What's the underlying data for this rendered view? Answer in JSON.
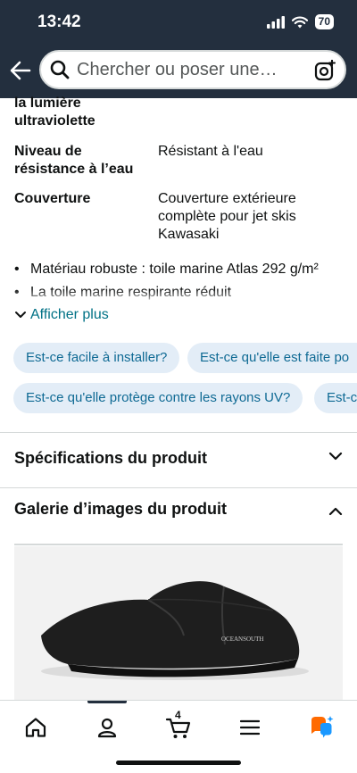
{
  "status": {
    "time": "13:42",
    "battery": "70"
  },
  "search": {
    "placeholder": "Chercher ou poser une…"
  },
  "specs": [
    {
      "key": "la lumière ultraviolette",
      "value": ""
    },
    {
      "key": "Niveau de résistance à l’eau",
      "value": "Résistant à l'eau"
    },
    {
      "key": "Couverture",
      "value": "Couverture extérieure complète pour jet skis Kawasaki"
    }
  ],
  "bullets": [
    "Matériau robuste : toile marine Atlas 292 g/m²",
    "La toile marine respirante réduit"
  ],
  "show_more": "Afficher plus",
  "questions": [
    "Est-ce facile à installer?",
    "Est-ce qu'elle est faite po",
    "Est-ce qu'elle protège contre les rayons UV?",
    "Est-c"
  ],
  "sections": {
    "specs_title": "Spécifications du produit",
    "gallery_title": "Galerie d’images du produit"
  },
  "gallery": {
    "brand_logo": "OCEANSOUTH"
  },
  "tabbar": {
    "cart_count": "4"
  }
}
